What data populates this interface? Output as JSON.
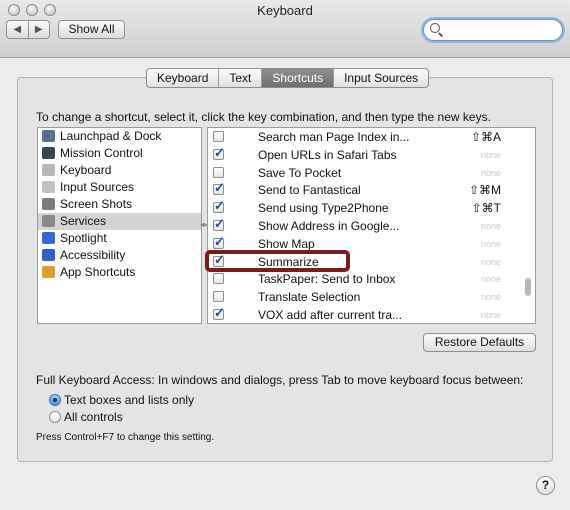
{
  "window": {
    "title": "Keyboard"
  },
  "toolbar": {
    "back": "◀",
    "forward": "▶",
    "show_all": "Show All",
    "search_value": ""
  },
  "tabs": [
    {
      "label": "Keyboard",
      "active": false
    },
    {
      "label": "Text",
      "active": false
    },
    {
      "label": "Shortcuts",
      "active": true
    },
    {
      "label": "Input Sources",
      "active": false
    }
  ],
  "instruction": "To change a shortcut, select it, click the key combination, and then type the new keys.",
  "categories": [
    {
      "label": "Launchpad & Dock",
      "icon": "launchpad-icon",
      "color": "#5a6f8e"
    },
    {
      "label": "Mission Control",
      "icon": "mission-control-icon",
      "color": "#3b4452"
    },
    {
      "label": "Keyboard",
      "icon": "keyboard-icon",
      "color": "#b7b7b7"
    },
    {
      "label": "Input Sources",
      "icon": "input-sources-icon",
      "color": "#c2c2c2"
    },
    {
      "label": "Screen Shots",
      "icon": "screenshot-icon",
      "color": "#7c7c7c"
    },
    {
      "label": "Services",
      "icon": "gear-icon",
      "color": "#8a8a8a",
      "selected": true
    },
    {
      "label": "Spotlight",
      "icon": "spotlight-icon",
      "color": "#2e6ad0"
    },
    {
      "label": "Accessibility",
      "icon": "accessibility-icon",
      "color": "#2d63c6"
    },
    {
      "label": "App Shortcuts",
      "icon": "app-shortcuts-icon",
      "color": "#e0a030"
    }
  ],
  "services": [
    {
      "label": "Search man Page Index in...",
      "checked": false,
      "key": "⇧⌘A"
    },
    {
      "label": "Open URLs in Safari Tabs",
      "checked": true,
      "key": "none"
    },
    {
      "label": "Save To Pocket",
      "checked": false,
      "key": "none"
    },
    {
      "label": "Send to Fantastical",
      "checked": true,
      "key": "⇧⌘M"
    },
    {
      "label": "Send using Type2Phone",
      "checked": true,
      "key": "⇧⌘T"
    },
    {
      "label": "Show Address in Google...",
      "checked": true,
      "key": "none"
    },
    {
      "label": "Show Map",
      "checked": true,
      "key": "none"
    },
    {
      "label": "Summarize",
      "checked": true,
      "key": "none"
    },
    {
      "label": "TaskPaper: Send to Inbox",
      "checked": false,
      "key": "none"
    },
    {
      "label": "Translate Selection",
      "checked": false,
      "key": "none"
    },
    {
      "label": "VOX add after current tra...",
      "checked": true,
      "key": "none"
    }
  ],
  "restore_defaults": "Restore Defaults",
  "fka": {
    "label": "Full Keyboard Access: In windows and dialogs, press Tab to move keyboard focus between:",
    "option1": "Text boxes and lists only",
    "option2": "All controls",
    "selected": 1,
    "note": "Press Control+F7 to change this setting."
  },
  "help": "?",
  "colors": {
    "highlight": "#7b1c1c",
    "checkmark": "#1f4f9a",
    "selected_row": "#d4d4d4"
  }
}
